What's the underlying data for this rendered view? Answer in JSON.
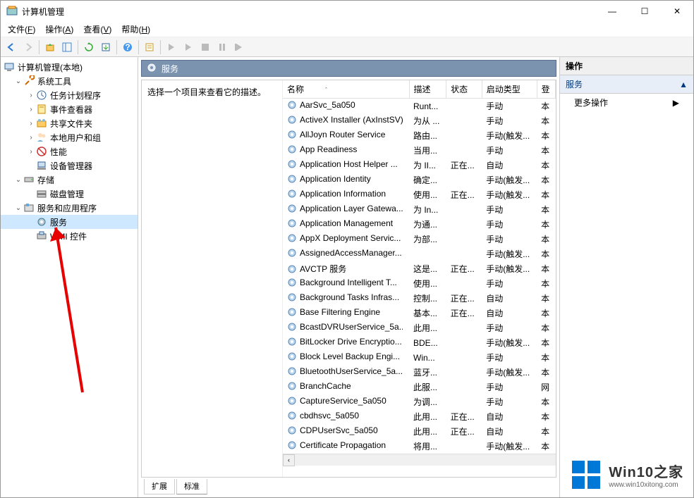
{
  "window": {
    "title": "计算机管理",
    "minimize": "—",
    "maximize": "☐",
    "close": "✕"
  },
  "menubar": [
    {
      "label": "文件",
      "key": "F"
    },
    {
      "label": "操作",
      "key": "A"
    },
    {
      "label": "查看",
      "key": "V"
    },
    {
      "label": "帮助",
      "key": "H"
    }
  ],
  "tree": {
    "root": "计算机管理(本地)",
    "system_tools": "系统工具",
    "task_scheduler": "任务计划程序",
    "event_viewer": "事件查看器",
    "shared_folders": "共享文件夹",
    "local_users": "本地用户和组",
    "performance": "性能",
    "device_manager": "设备管理器",
    "storage": "存储",
    "disk_management": "磁盘管理",
    "services_apps": "服务和应用程序",
    "services": "服务",
    "wmi": "WMI 控件"
  },
  "services_panel": {
    "title": "服务",
    "description_prompt": "选择一个项目来查看它的描述。",
    "columns": {
      "name": "名称",
      "description": "描述",
      "status": "状态",
      "startup": "启动类型",
      "login": "登"
    },
    "rows": [
      {
        "name": "AarSvc_5a050",
        "desc": "Runt...",
        "status": "",
        "startup": "手动",
        "login": "本"
      },
      {
        "name": "ActiveX Installer (AxInstSV)",
        "desc": "为从 ...",
        "status": "",
        "startup": "手动",
        "login": "本"
      },
      {
        "name": "AllJoyn Router Service",
        "desc": "路由...",
        "status": "",
        "startup": "手动(触发...",
        "login": "本"
      },
      {
        "name": "App Readiness",
        "desc": "当用...",
        "status": "",
        "startup": "手动",
        "login": "本"
      },
      {
        "name": "Application Host Helper ...",
        "desc": "为 II...",
        "status": "正在...",
        "startup": "自动",
        "login": "本"
      },
      {
        "name": "Application Identity",
        "desc": "确定...",
        "status": "",
        "startup": "手动(触发...",
        "login": "本"
      },
      {
        "name": "Application Information",
        "desc": "使用...",
        "status": "正在...",
        "startup": "手动(触发...",
        "login": "本"
      },
      {
        "name": "Application Layer Gatewa...",
        "desc": "为 In...",
        "status": "",
        "startup": "手动",
        "login": "本"
      },
      {
        "name": "Application Management",
        "desc": "为通...",
        "status": "",
        "startup": "手动",
        "login": "本"
      },
      {
        "name": "AppX Deployment Servic...",
        "desc": "为部...",
        "status": "",
        "startup": "手动",
        "login": "本"
      },
      {
        "name": "AssignedAccessManager...",
        "desc": "",
        "status": "",
        "startup": "手动(触发...",
        "login": "本"
      },
      {
        "name": "AVCTP 服务",
        "desc": "这是...",
        "status": "正在...",
        "startup": "手动(触发...",
        "login": "本"
      },
      {
        "name": "Background Intelligent T...",
        "desc": "使用...",
        "status": "",
        "startup": "手动",
        "login": "本"
      },
      {
        "name": "Background Tasks Infras...",
        "desc": "控制...",
        "status": "正在...",
        "startup": "自动",
        "login": "本"
      },
      {
        "name": "Base Filtering Engine",
        "desc": "基本...",
        "status": "正在...",
        "startup": "自动",
        "login": "本"
      },
      {
        "name": "BcastDVRUserService_5a...",
        "desc": "此用...",
        "status": "",
        "startup": "手动",
        "login": "本"
      },
      {
        "name": "BitLocker Drive Encryptio...",
        "desc": "BDE...",
        "status": "",
        "startup": "手动(触发...",
        "login": "本"
      },
      {
        "name": "Block Level Backup Engi...",
        "desc": "Win...",
        "status": "",
        "startup": "手动",
        "login": "本"
      },
      {
        "name": "BluetoothUserService_5a...",
        "desc": "蓝牙...",
        "status": "",
        "startup": "手动(触发...",
        "login": "本"
      },
      {
        "name": "BranchCache",
        "desc": "此服...",
        "status": "",
        "startup": "手动",
        "login": "网"
      },
      {
        "name": "CaptureService_5a050",
        "desc": "为调...",
        "status": "",
        "startup": "手动",
        "login": "本"
      },
      {
        "name": "cbdhsvc_5a050",
        "desc": "此用...",
        "status": "正在...",
        "startup": "自动",
        "login": "本"
      },
      {
        "name": "CDPUserSvc_5a050",
        "desc": "此用...",
        "status": "正在...",
        "startup": "自动",
        "login": "本"
      },
      {
        "name": "Certificate Propagation",
        "desc": "将用...",
        "status": "",
        "startup": "手动(触发...",
        "login": "本"
      }
    ],
    "tabs": {
      "extended": "扩展",
      "standard": "标准"
    }
  },
  "actions_pane": {
    "header": "操作",
    "subheader": "服务",
    "more_actions": "更多操作"
  },
  "watermark": {
    "title": "Win10之家",
    "url": "www.win10xitong.com"
  }
}
